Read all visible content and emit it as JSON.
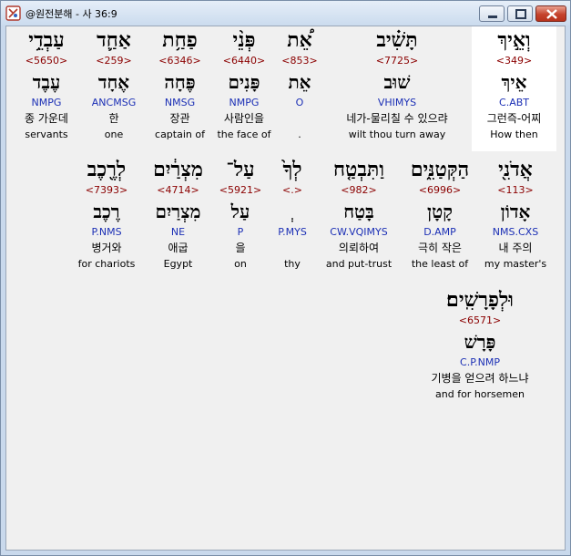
{
  "window": {
    "title": "@원전분해 - 사 36:9"
  },
  "words": [
    {
      "heb": "וְאֵ֣יךְ",
      "strong": "<349>",
      "lemma": "אֵיךְ",
      "morph": "C.ABT",
      "kor": "그런즉-어찌",
      "eng": "How then"
    },
    {
      "heb": "תָּשִׁ֗יב",
      "strong": "<7725>",
      "lemma": "שׁוּב",
      "morph": "VHIMYS",
      "kor": "네가-물리칠 수 있으랴",
      "eng": "wilt thou turn away"
    },
    {
      "heb": "אֵ֠ת",
      "strong": "<853>",
      "lemma": "אֵת",
      "morph": "O",
      "kor": "",
      "eng": "."
    },
    {
      "heb": "פְּנֵ֨י",
      "strong": "<6440>",
      "lemma": "פָּנִים",
      "morph": "NMPG",
      "kor": "사람인을",
      "eng": "the face of"
    },
    {
      "heb": "פַחַ֥ת",
      "strong": "<6346>",
      "lemma": "פֶּחָה",
      "morph": "NMSG",
      "kor": "장관",
      "eng": "captain of"
    },
    {
      "heb": "אַחַ֛ד",
      "strong": "<259>",
      "lemma": "אֶחָד",
      "morph": "ANCMSG",
      "kor": "한",
      "eng": "one"
    },
    {
      "heb": "עַבְדֵ֥י",
      "strong": "<5650>",
      "lemma": "עֶבֶד",
      "morph": "NMPG",
      "kor": "종 가운데",
      "eng": "servants"
    },
    {
      "heb": "אֲדֹנִ֖י",
      "strong": "<113>",
      "lemma": "אָדוֹן",
      "morph": "NMS.CXS",
      "kor": "내 주의",
      "eng": "my master's"
    },
    {
      "heb": "הַקְּטַנִּ֑ים",
      "strong": "<6996>",
      "lemma": "קָטָן",
      "morph": "D.AMP",
      "kor": "극히 작은",
      "eng": "the least of"
    },
    {
      "heb": "וַתִּבְטַ֤ח",
      "strong": "<982>",
      "lemma": "בָּטַח",
      "morph": "CW.VQIMYS",
      "kor": "의뢰하여",
      "eng": "and put-trust"
    },
    {
      "heb": "לְךָ֙",
      "strong": "<.>",
      "lemma": "ְ",
      "morph": "P.MYS",
      "kor": "",
      "eng": "thy"
    },
    {
      "heb": "עַל־",
      "strong": "<5921>",
      "lemma": "עַל",
      "morph": "P",
      "kor": "을",
      "eng": "on"
    },
    {
      "heb": "מִצְרַ֔יִם",
      "strong": "<4714>",
      "lemma": "מִצְרַיִם",
      "morph": "NE",
      "kor": "애굽",
      "eng": "Egypt"
    },
    {
      "heb": "לְרֶ֖כֶב",
      "strong": "<7393>",
      "lemma": "רֶכֶב",
      "morph": "P.NMS",
      "kor": "병거와",
      "eng": "for chariots"
    },
    {
      "heb": "וּלְפָרָשִֽׁים׃",
      "strong": "<6571>",
      "lemma": "פָּרָשׁ",
      "morph": "C.P.NMP",
      "kor": "기병을 얻으려 하느냐",
      "eng": "and for horsemen"
    }
  ]
}
